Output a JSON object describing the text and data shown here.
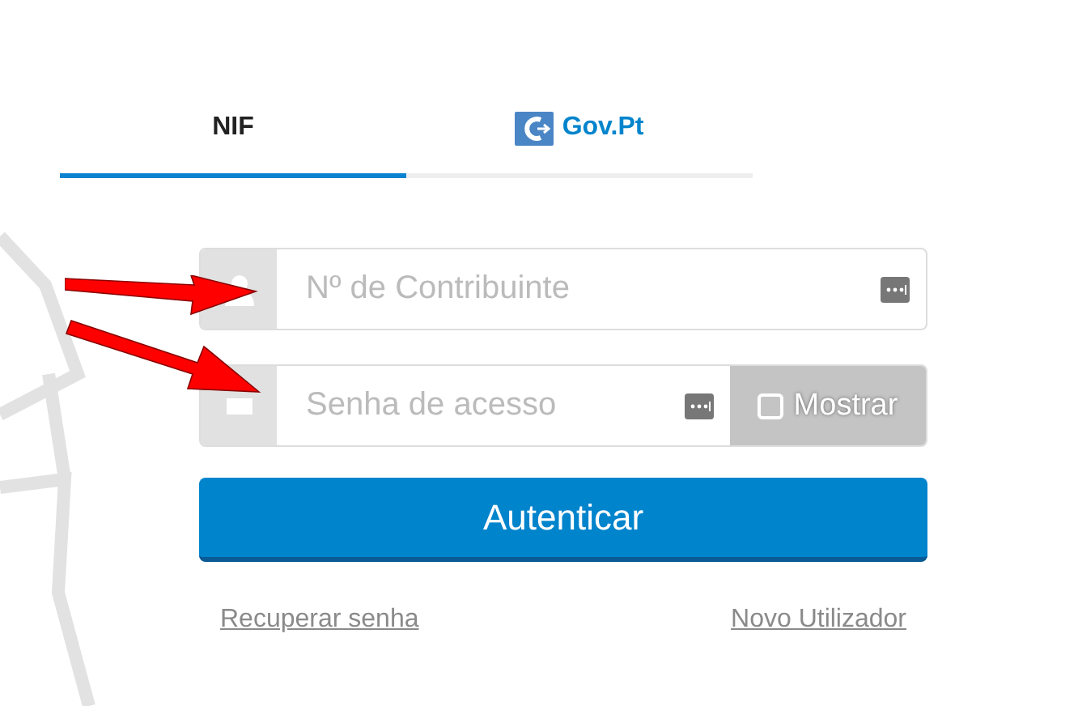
{
  "tabs": [
    {
      "label": "NIF",
      "selected": true,
      "kind": "plain"
    },
    {
      "label": "Gov.Pt",
      "selected": false,
      "kind": "logo"
    }
  ],
  "form": {
    "taxpayer_field": {
      "placeholder": "Nº de Contribuinte"
    },
    "password_field": {
      "placeholder": "Senha de acesso"
    },
    "show_password": {
      "label": "Mostrar",
      "checked": false
    },
    "submit_button": "Autenticar",
    "links": [
      "Recuperar senha",
      "Novo Utilizador"
    ]
  }
}
